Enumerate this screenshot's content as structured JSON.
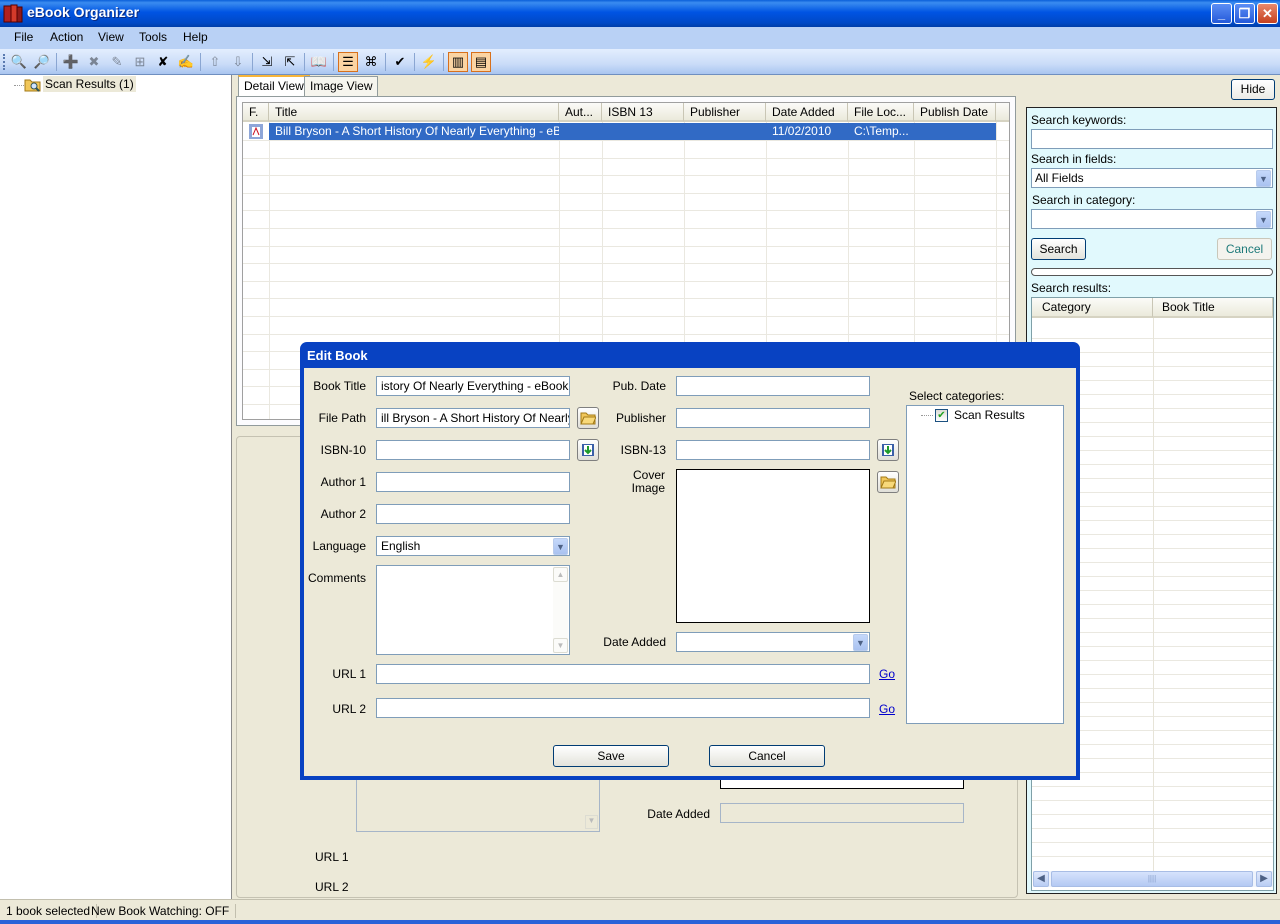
{
  "window": {
    "title": "eBook Organizer",
    "minimize_label": "_",
    "restore_label": "❐",
    "close_label": "✕"
  },
  "menu": [
    "File",
    "Action",
    "View",
    "Tools",
    "Help"
  ],
  "toolbar": {
    "buttons": [
      {
        "icon": "open-folder-search-icon",
        "glyph": "🔍",
        "enabled": true
      },
      {
        "icon": "search-icon",
        "glyph": "🔎",
        "enabled": true
      },
      {
        "icon": "add-book-icon",
        "glyph": "➕",
        "enabled": true
      },
      {
        "icon": "remove-book-icon",
        "glyph": "✖",
        "enabled": false
      },
      {
        "icon": "edit-icon",
        "glyph": "✎",
        "enabled": false
      },
      {
        "icon": "add-to-category-icon",
        "glyph": "⊞",
        "enabled": false
      },
      {
        "icon": "delete-icon",
        "glyph": "✘",
        "enabled": true
      },
      {
        "icon": "edit-book-icon",
        "glyph": "✍",
        "enabled": true
      },
      {
        "icon": "move-up-icon",
        "glyph": "⇧",
        "enabled": false
      },
      {
        "icon": "move-down-icon",
        "glyph": "⇩",
        "enabled": false
      },
      {
        "icon": "import-icon",
        "glyph": "⇲",
        "enabled": true
      },
      {
        "icon": "export-icon",
        "glyph": "⇱",
        "enabled": true
      },
      {
        "icon": "book-info-icon",
        "glyph": "📖",
        "enabled": true
      },
      {
        "icon": "detail-view-icon",
        "glyph": "☰",
        "enabled": true,
        "active": true
      },
      {
        "icon": "pdf-icon",
        "glyph": "⌘",
        "enabled": true
      },
      {
        "icon": "check-icon",
        "glyph": "✔",
        "enabled": true
      },
      {
        "icon": "settings-icon",
        "glyph": "⚡",
        "enabled": true
      },
      {
        "icon": "layout-left-icon",
        "glyph": "▥",
        "enabled": true,
        "active": true
      },
      {
        "icon": "layout-bottom-icon",
        "glyph": "▤",
        "enabled": true,
        "active": true
      }
    ]
  },
  "tree": {
    "root_label": "Scan Results (1)"
  },
  "tabs": {
    "detail": "Detail View",
    "image": "Image View"
  },
  "grid": {
    "columns": [
      "F.",
      "Title",
      "Aut...",
      "ISBN 13",
      "Publisher",
      "Date Added",
      "File Loc...",
      "Publish Date"
    ],
    "rows": [
      {
        "format_icon": "pdf-icon",
        "title": "Bill Bryson - A Short History Of Nearly Everything - eBook...",
        "author": "",
        "isbn13": "",
        "publisher": "",
        "date_added": "11/02/2010",
        "file_location": "C:\\Temp...",
        "publish_date": ""
      }
    ]
  },
  "background_panel": {
    "date_added_label": "Date Added",
    "url1_label": "URL 1",
    "url2_label": "URL 2"
  },
  "search_panel": {
    "hide_label": "Hide",
    "keywords_label": "Search keywords:",
    "keywords_value": "",
    "fields_label": "Search in fields:",
    "fields_value": "All Fields",
    "category_label": "Search in category:",
    "category_value": "",
    "search_button": "Search",
    "cancel_button": "Cancel",
    "progress": 0,
    "results_label": "Search results:",
    "results_columns": [
      "Category",
      "Book Title"
    ]
  },
  "dialog": {
    "title": "Edit Book",
    "book_title_label": "Book Title",
    "book_title_value": "istory Of Nearly Everything - eBook.pdf",
    "file_path_label": "File Path",
    "file_path_value": "ill Bryson - A Short History Of Nearly Ev",
    "isbn10_label": "ISBN-10",
    "isbn10_value": "",
    "author1_label": "Author 1",
    "author1_value": "",
    "author2_label": "Author 2",
    "author2_value": "",
    "language_label": "Language",
    "language_value": "English",
    "comments_label": "Comments",
    "comments_value": "",
    "pub_date_label": "Pub. Date",
    "pub_date_value": "",
    "publisher_label": "Publisher",
    "publisher_value": "",
    "isbn13_label": "ISBN-13",
    "isbn13_value": "",
    "cover_image_label": "Cover Image",
    "date_added_label": "Date Added",
    "date_added_value": "",
    "url1_label": "URL 1",
    "url1_value": "",
    "url2_label": "URL 2",
    "url2_value": "",
    "go_label": "Go",
    "categories_label": "Select categories:",
    "categories": [
      {
        "label": "Scan Results",
        "checked": true
      }
    ],
    "save_button": "Save",
    "cancel_button": "Cancel"
  },
  "status_bar": {
    "selection": "1 book selected",
    "watching": "New Book Watching: OFF"
  }
}
